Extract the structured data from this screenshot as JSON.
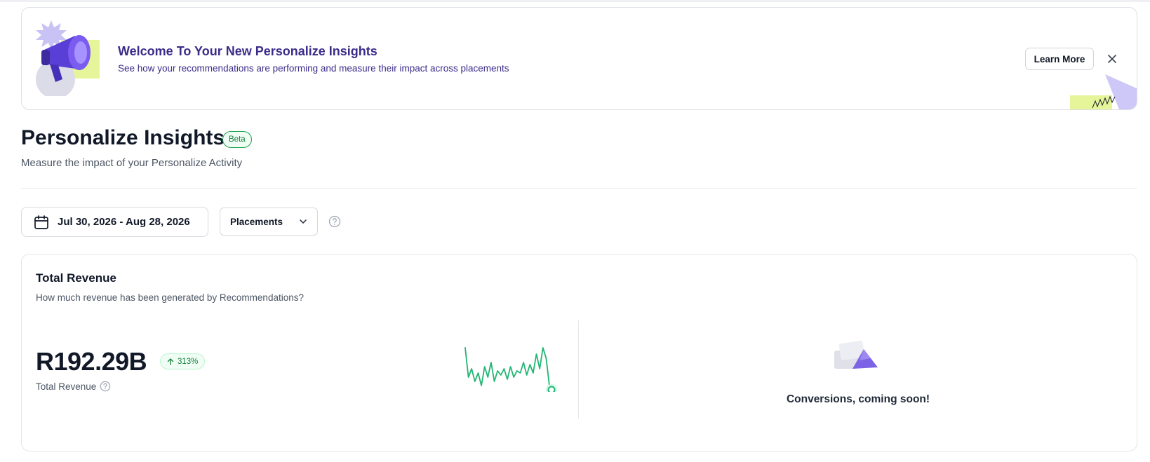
{
  "banner": {
    "title": "Welcome To Your New Personalize Insights",
    "subtitle": "See how your recommendations are performing and measure their impact across placements",
    "learn_more": "Learn More",
    "illustration_icon": "megaphone-icon",
    "close_icon": "close-icon"
  },
  "header": {
    "title": "Personalize Insights",
    "badge": "Beta",
    "subtitle": "Measure the impact of your Personalize Activity"
  },
  "filters": {
    "date_range": "Jul 30, 2026 - Aug 28, 2026",
    "date_icon": "calendar-icon",
    "placements": "Placements",
    "placements_icon": "chevron-down-icon",
    "help_icon": "help-circle-icon"
  },
  "revenue_card": {
    "title": "Total Revenue",
    "subtitle": "How much revenue has been generated by Recommendations?",
    "value": "R192.29B",
    "change": "313%",
    "change_icon": "arrow-up-icon",
    "label": "Total Revenue",
    "label_help_icon": "help-circle-icon",
    "sparkline": [
      0.95,
      0.25,
      0.45,
      0.15,
      0.35,
      0.05,
      0.5,
      0.25,
      0.6,
      0.15,
      0.4,
      0.3,
      0.45,
      0.2,
      0.5,
      0.25,
      0.4,
      0.35,
      0.6,
      0.3,
      0.55,
      0.35,
      0.8,
      0.45,
      0.95,
      0.7,
      0.05
    ],
    "conversions_text": "Conversions, coming soon!"
  },
  "colors": {
    "brand_purple": "#3b2c8a",
    "accent_green": "#16a34a",
    "sparkline": "#22b573"
  }
}
